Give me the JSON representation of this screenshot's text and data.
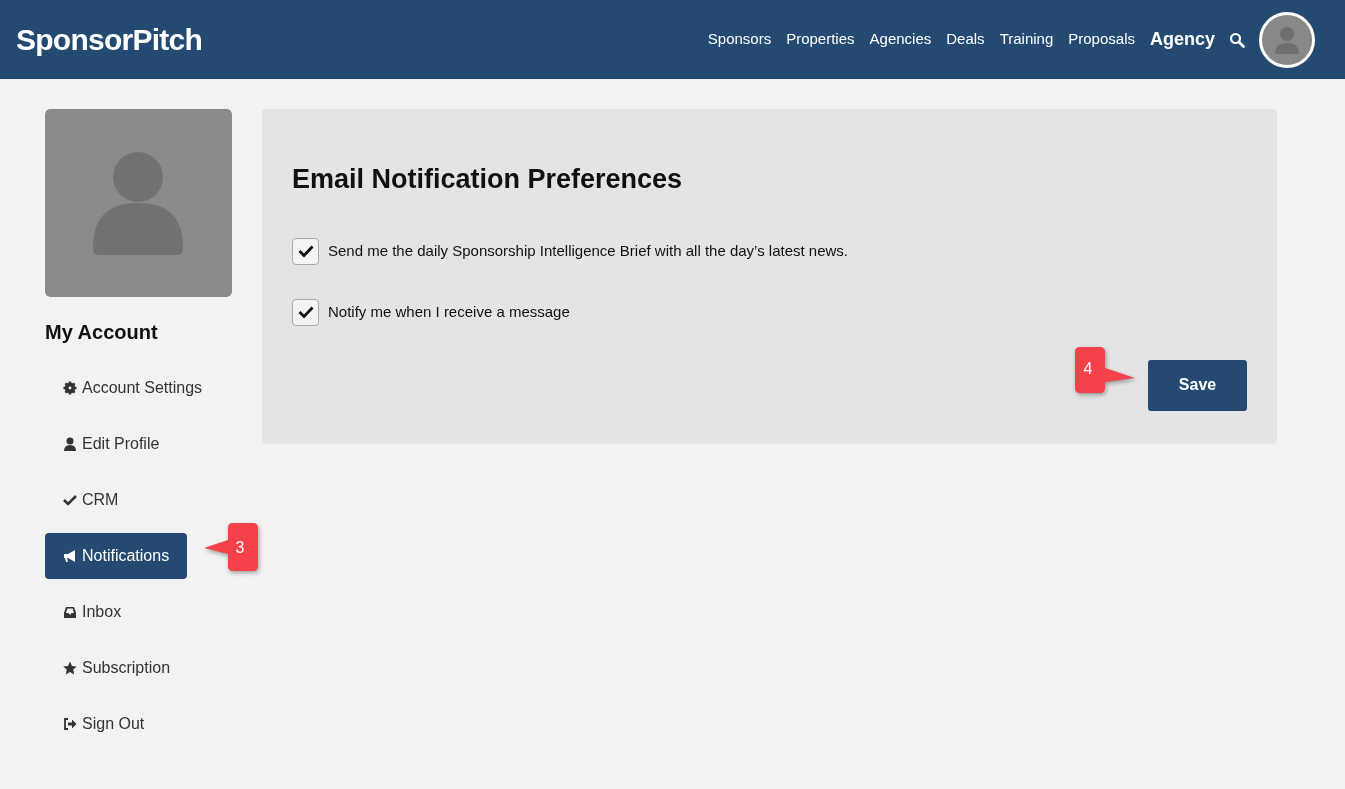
{
  "header": {
    "logo": "SponsorPitch",
    "nav": [
      {
        "label": "Sponsors",
        "kind": "link"
      },
      {
        "label": "Properties",
        "kind": "link"
      },
      {
        "label": "Agencies",
        "kind": "link"
      },
      {
        "label": "Deals",
        "kind": "link"
      },
      {
        "label": "Training",
        "kind": "link"
      },
      {
        "label": "Proposals",
        "kind": "link"
      },
      {
        "label": "Agency",
        "kind": "account"
      }
    ]
  },
  "sidebar": {
    "title": "My Account",
    "items": [
      {
        "label": "Account Settings",
        "selected": false
      },
      {
        "label": "Edit Profile",
        "selected": false
      },
      {
        "label": "CRM",
        "selected": false
      },
      {
        "label": "Notifications",
        "selected": true
      },
      {
        "label": "Inbox",
        "selected": false
      },
      {
        "label": "Subscription",
        "selected": false
      },
      {
        "label": "Sign Out",
        "selected": false
      }
    ]
  },
  "panel": {
    "title": "Email Notification Preferences",
    "options": [
      {
        "label": "Send me the daily Sponsorship Intelligence Brief with all the day’s latest news.",
        "checked": true
      },
      {
        "label": "Notify me when I receive a message",
        "checked": true
      }
    ],
    "save_button": "Save"
  },
  "callouts": [
    {
      "label": "3",
      "kind": "left"
    },
    {
      "label": "4",
      "kind": "right"
    }
  ]
}
